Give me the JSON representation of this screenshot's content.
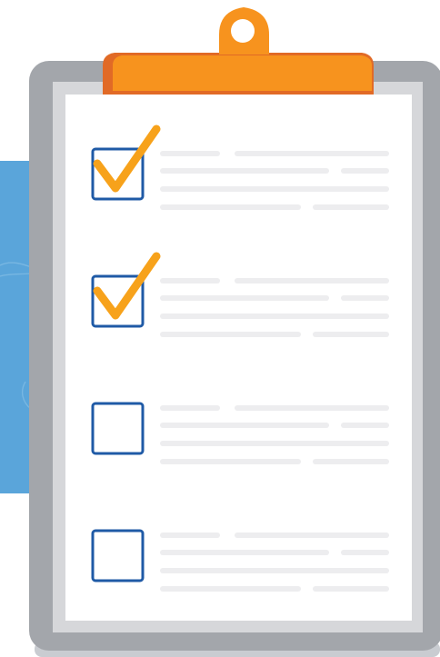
{
  "illustration": {
    "subject": "clipboard-checklist",
    "colors": {
      "background": "#ffffff",
      "blue_panel": "#5aa5da",
      "clipboard_shadow": "#c9ccd1",
      "clipboard_board": "#a3a6ab",
      "paper_back": "#d6d7da",
      "paper": "#ffffff",
      "clip_orange": "#f7931e",
      "clip_orange_dark": "#e16a26",
      "checkbox_border": "#1f5aa6",
      "checkmark": "#f7a21b",
      "text_placeholder": "#ededef"
    },
    "checklist": {
      "items": [
        {
          "checked": true,
          "icon": "checkbox-checked-icon"
        },
        {
          "checked": true,
          "icon": "checkbox-checked-icon"
        },
        {
          "checked": false,
          "icon": "checkbox-empty-icon"
        },
        {
          "checked": false,
          "icon": "checkbox-empty-icon"
        }
      ]
    }
  }
}
